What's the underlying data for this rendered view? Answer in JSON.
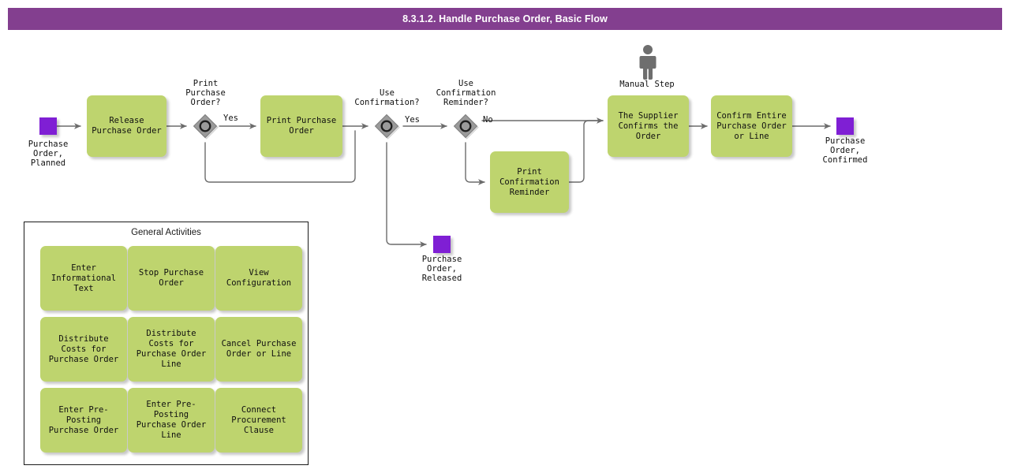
{
  "header": {
    "title": "8.3.1.2. Handle Purchase Order, Basic Flow",
    "bar_color": "#833f8f",
    "text_color": "#ffffff"
  },
  "palette": {
    "task_fill": "#bed46e",
    "event_fill": "#7f1fd4",
    "gateway_fill": "#9a9a9a",
    "gateway_stroke": "#3a3a3a",
    "connector": "#6b6b6b",
    "marker_gray": "#6e6e6e",
    "panel_border": "#1a1a1a"
  },
  "flow": {
    "start_event": {
      "name": "start-event-purchase-order-planned",
      "label": "Purchase\nOrder,\nPlanned"
    },
    "end_event_released": {
      "name": "end-event-purchase-order-released",
      "label": "Purchase\nOrder,\nReleased"
    },
    "end_event_confirmed": {
      "name": "end-event-purchase-order-confirmed",
      "label": "Purchase\nOrder,\nConfirmed"
    },
    "tasks": [
      {
        "id": "release-purchase-order",
        "label": "Release\nPurchase Order"
      },
      {
        "id": "print-purchase-order",
        "label": "Print Purchase\nOrder"
      },
      {
        "id": "print-confirmation-reminder",
        "label": "Print\nConfirmation\nReminder"
      },
      {
        "id": "the-supplier-confirms-the-order",
        "label": "The Supplier\nConfirms the\nOrder"
      },
      {
        "id": "confirm-entire-purchase-order-or-line",
        "label": "Confirm Entire\nPurchase Order\nor Line"
      }
    ],
    "gateways": [
      {
        "id": "print-purchase-order-gateway",
        "label": "Print\nPurchase\nOrder?",
        "branch_label": "Yes"
      },
      {
        "id": "use-confirmation-gateway",
        "label": "Use\nConfirmation?",
        "branch_label": "Yes"
      },
      {
        "id": "use-confirmation-reminder-gateway",
        "label": "Use\nConfirmation\nReminder?",
        "branch_label": "No"
      }
    ],
    "markers": [
      {
        "id": "manual-step",
        "label": "Manual Step",
        "icon": "person-icon"
      }
    ]
  },
  "general_activities": {
    "title": "General Activities",
    "items": [
      {
        "id": "enter-informational-text",
        "label": "Enter\nInformational\nText"
      },
      {
        "id": "stop-purchase-order",
        "label": "Stop Purchase\nOrder"
      },
      {
        "id": "view-configuration",
        "label": "View\nConfiguration"
      },
      {
        "id": "distribute-costs-for-purchase-order",
        "label": "Distribute Costs\nfor Purchase\nOrder"
      },
      {
        "id": "distribute-costs-for-purchase-order-line",
        "label": "Distribute Costs\nfor Purchase\nOrder Line"
      },
      {
        "id": "cancel-purchase-order-or-line",
        "label": "Cancel Purchase\nOrder or Line"
      },
      {
        "id": "enter-pre-posting-purchase-order",
        "label": "Enter Pre-\nPosting\nPurchase Order"
      },
      {
        "id": "enter-pre-posting-purchase-order-line",
        "label": "Enter Pre-\nPosting\nPurchase Order\nLine"
      },
      {
        "id": "connect-procurement-clause",
        "label": "Connect\nProcurement\nClause"
      }
    ]
  }
}
